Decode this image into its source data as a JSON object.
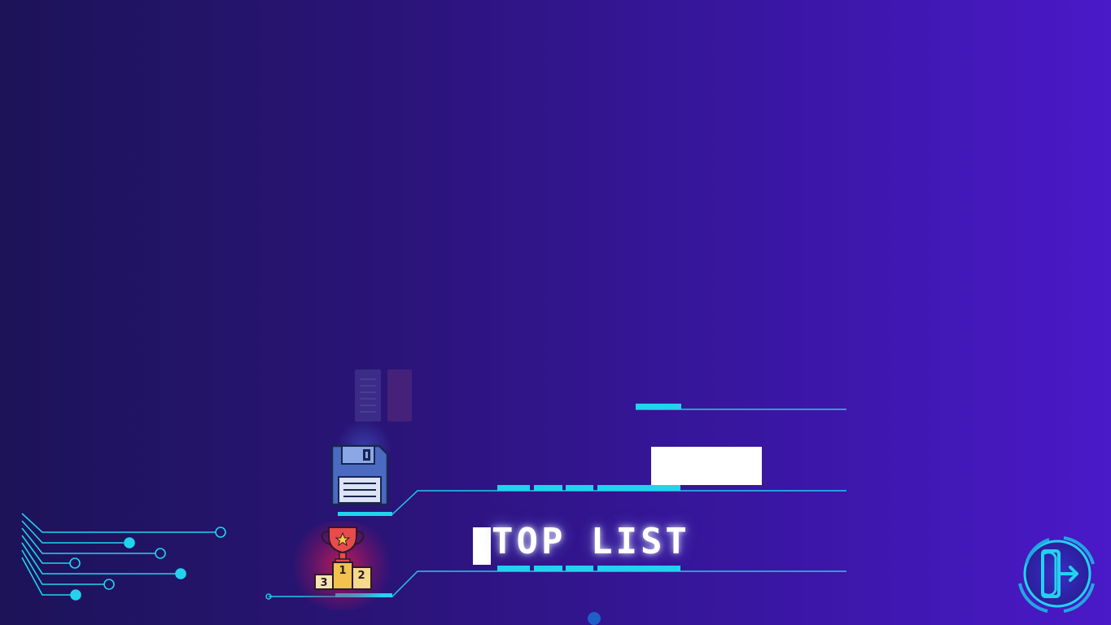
{
  "menu": {
    "top_list_label": "TOP LIST"
  },
  "name_input": {
    "value": ""
  },
  "icons": {
    "save": "floppy-disk-icon",
    "leaderboard": "trophy-podium-icon",
    "exit": "exit-door-icon",
    "code": "code-list-icon"
  },
  "colors": {
    "accent": "#22d3ee",
    "background_left": "#1c1358",
    "background_right": "#4a19c8",
    "trophy_glow": "#e61e50"
  }
}
